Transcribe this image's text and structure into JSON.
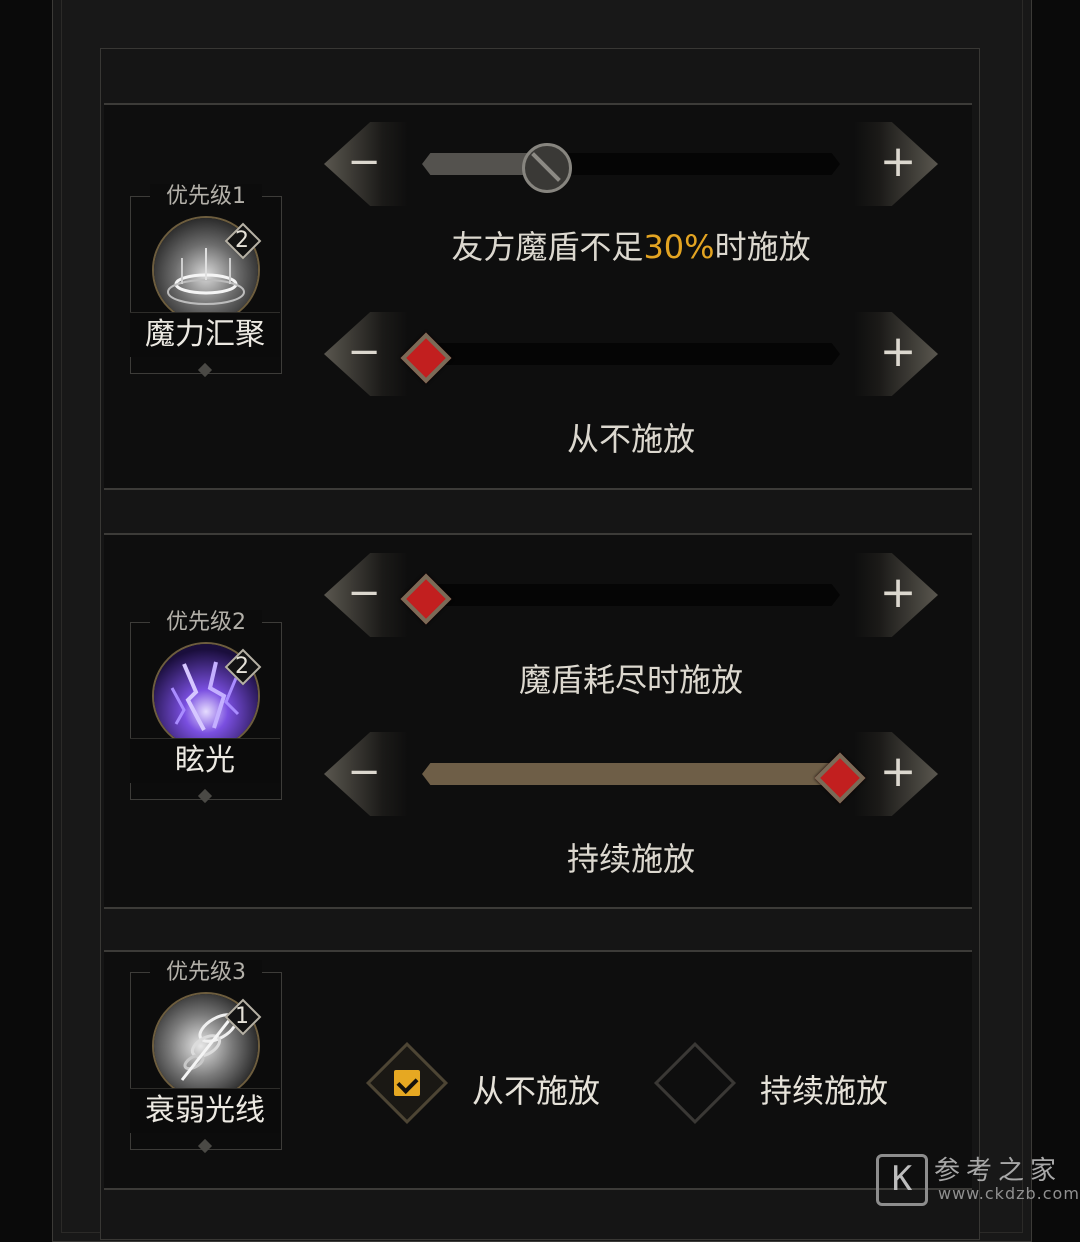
{
  "skills": [
    {
      "priority": "优先级1",
      "name": "魔力汇聚",
      "level": "2",
      "conditions": [
        {
          "minus": "−",
          "plus": "+",
          "value_percent": 30,
          "disabled": true,
          "caption_prefix": "友方魔盾不足",
          "caption_highlight": "30%",
          "caption_suffix": "时施放"
        },
        {
          "minus": "−",
          "plus": "+",
          "value_percent": 0,
          "disabled": false,
          "caption": "从不施放"
        }
      ]
    },
    {
      "priority": "优先级2",
      "name": "眩光",
      "level": "2",
      "conditions": [
        {
          "minus": "−",
          "plus": "+",
          "value_percent": 0,
          "disabled": false,
          "caption": "魔盾耗尽时施放"
        },
        {
          "minus": "−",
          "plus": "+",
          "value_percent": 100,
          "disabled": false,
          "caption": "持续施放"
        }
      ]
    },
    {
      "priority": "优先级3",
      "name": "衰弱光线",
      "level": "1",
      "options": [
        {
          "label": "从不施放",
          "checked": true
        },
        {
          "label": "持续施放",
          "checked": false
        }
      ]
    }
  ],
  "colors": {
    "highlight": "#e3a422",
    "gem": "#c21f1f",
    "fill": "#6e5e47"
  },
  "watermark": {
    "logo": "K",
    "title": "参考之家",
    "url": "www.ckdzb.com"
  }
}
